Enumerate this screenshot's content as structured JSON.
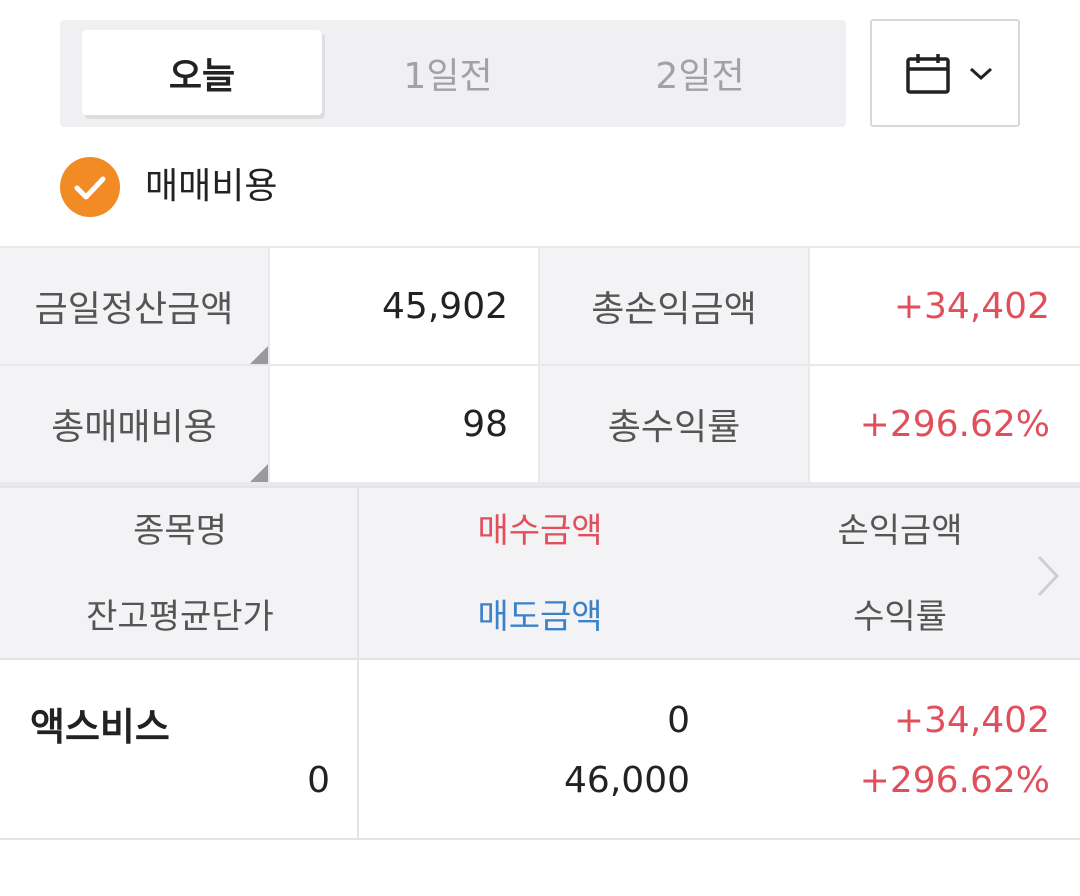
{
  "tabs": [
    {
      "label": "오늘",
      "active": true
    },
    {
      "label": "1일전",
      "active": false
    },
    {
      "label": "2일전",
      "active": false
    }
  ],
  "calendar_button": {
    "icon": "calendar-icon",
    "chevron": "chevron-down-icon"
  },
  "fee_toggle": {
    "label": "매매비용",
    "checked": true,
    "color": "#f28b24"
  },
  "summary": {
    "settle_label": "금일정산금액",
    "settle_value": "45,902",
    "pl_label": "총손익금액",
    "pl_value": "+34,402",
    "fee_label": "총매매비용",
    "fee_value": "98",
    "return_label": "총수익률",
    "return_value": "+296.62%"
  },
  "columns": {
    "name": "종목명",
    "avg_price": "잔고평균단가",
    "buy_amount": "매수금액",
    "sell_amount": "매도금액",
    "pl_amount": "손익금액",
    "return_rate": "수익률"
  },
  "rows": [
    {
      "name": "액스비스",
      "avg_price": "0",
      "buy_amount": "0",
      "sell_amount": "46,000",
      "pl_amount": "+34,402",
      "return_rate": "+296.62%"
    }
  ],
  "colors": {
    "positive": "#e0505c",
    "sell": "#3b82c6",
    "accent": "#f28b24"
  }
}
